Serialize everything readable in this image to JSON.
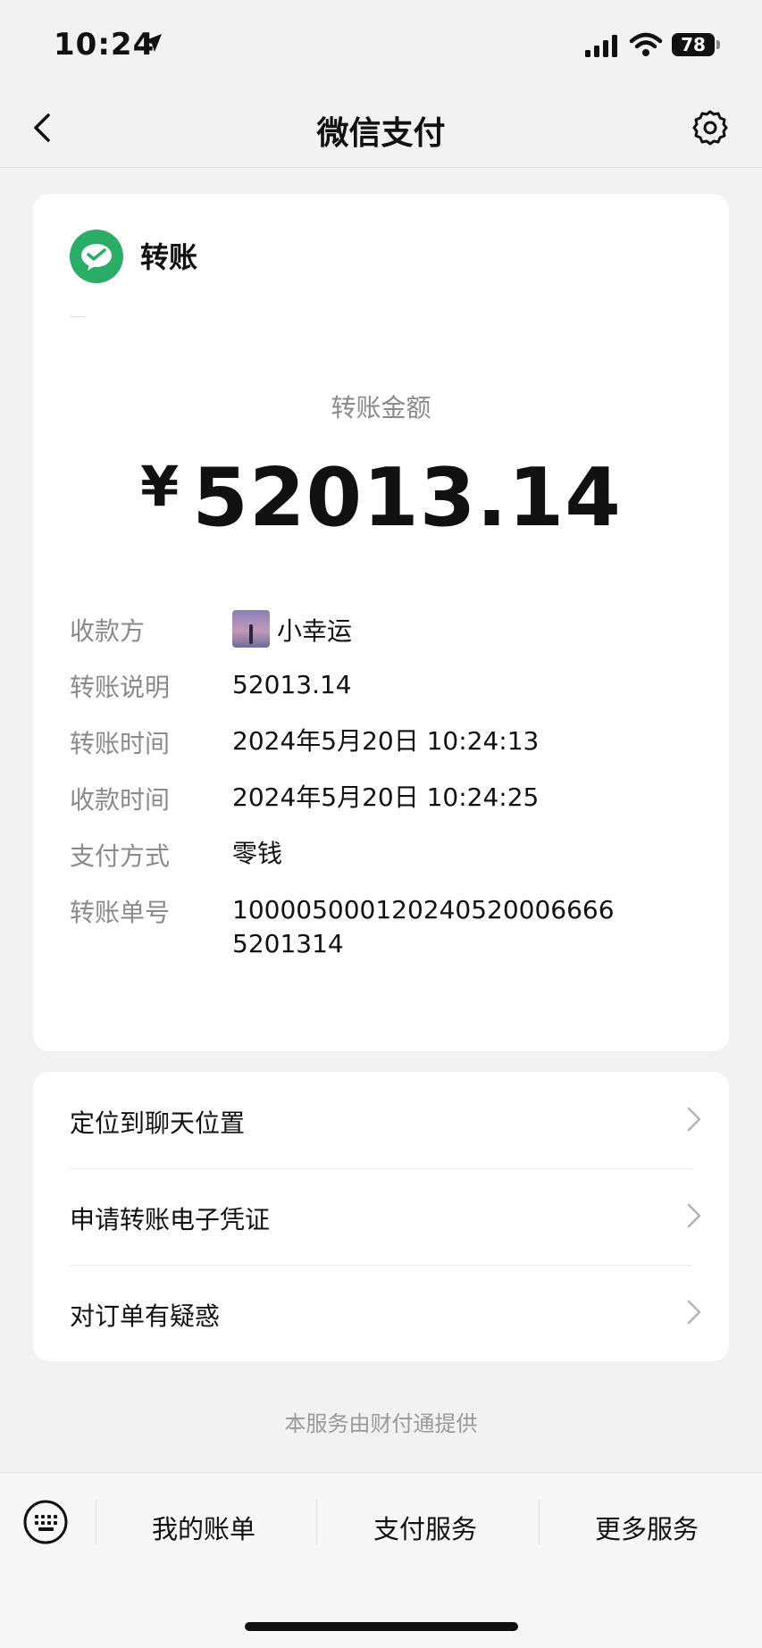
{
  "status_bar": {
    "time": "10:24",
    "battery": "78"
  },
  "nav": {
    "title": "微信支付"
  },
  "transfer": {
    "title": "转账",
    "amount_label": "转账金额",
    "currency": "¥",
    "amount": "52013.14",
    "details": [
      {
        "label": "收款方",
        "value": "小幸运"
      },
      {
        "label": "转账说明",
        "value": "52013.14"
      },
      {
        "label": "转账时间",
        "value": "2024年5月20日 10:24:13"
      },
      {
        "label": "收款时间",
        "value": "2024年5月20日 10:24:25"
      },
      {
        "label": "支付方式",
        "value": "零钱"
      },
      {
        "label": "转账单号",
        "value_line1": "100005000120240520006666",
        "value_line2": "5201314"
      }
    ]
  },
  "menu": {
    "items": [
      {
        "label": "定位到聊天位置"
      },
      {
        "label": "申请转账电子凭证"
      },
      {
        "label": "对订单有疑惑"
      }
    ]
  },
  "footer_note": "本服务由财付通提供",
  "tab_bar": {
    "tabs": [
      {
        "label": "我的账单"
      },
      {
        "label": "支付服务"
      },
      {
        "label": "更多服务"
      }
    ]
  },
  "colors": {
    "accent": "#2aae67",
    "background": "#f2f2f2",
    "muted_text": "#8a8a8a"
  }
}
